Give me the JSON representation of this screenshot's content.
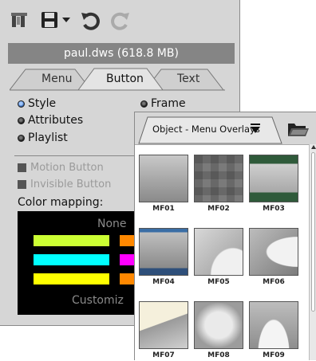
{
  "toolbar": {
    "icons": [
      "tools-icon",
      "save-icon",
      "dropdown-arrow-icon",
      "undo-icon",
      "redo-icon"
    ]
  },
  "file": {
    "name_size": "paul.dws (618.8 MB)"
  },
  "tabs": [
    {
      "label": "Menu",
      "active": false
    },
    {
      "label": "Button",
      "active": true
    },
    {
      "label": "Text",
      "active": false
    }
  ],
  "properties": {
    "style": "Style",
    "frame": "Frame",
    "attributes": "Attributes",
    "playlist": "Playlist"
  },
  "options": {
    "motion_button": "Motion Button",
    "invisible_button": "Invisible Button",
    "color_mapping_label": "Color mapping:",
    "none_label": "None",
    "customize_label": "Customiz"
  },
  "overlay": {
    "tab_label": "Object - Menu Overlays",
    "items": [
      "MF01",
      "MF02",
      "MF03",
      "MF04",
      "MF05",
      "MF06",
      "MF07",
      "MF08",
      "MF09"
    ]
  },
  "colors": {
    "bar_yellow_green": "#ccff33",
    "bar_cyan": "#00ffff",
    "bar_yellow": "#ffff00",
    "bar_orange": "#ff8800",
    "bar_magenta": "#ff00ff"
  }
}
